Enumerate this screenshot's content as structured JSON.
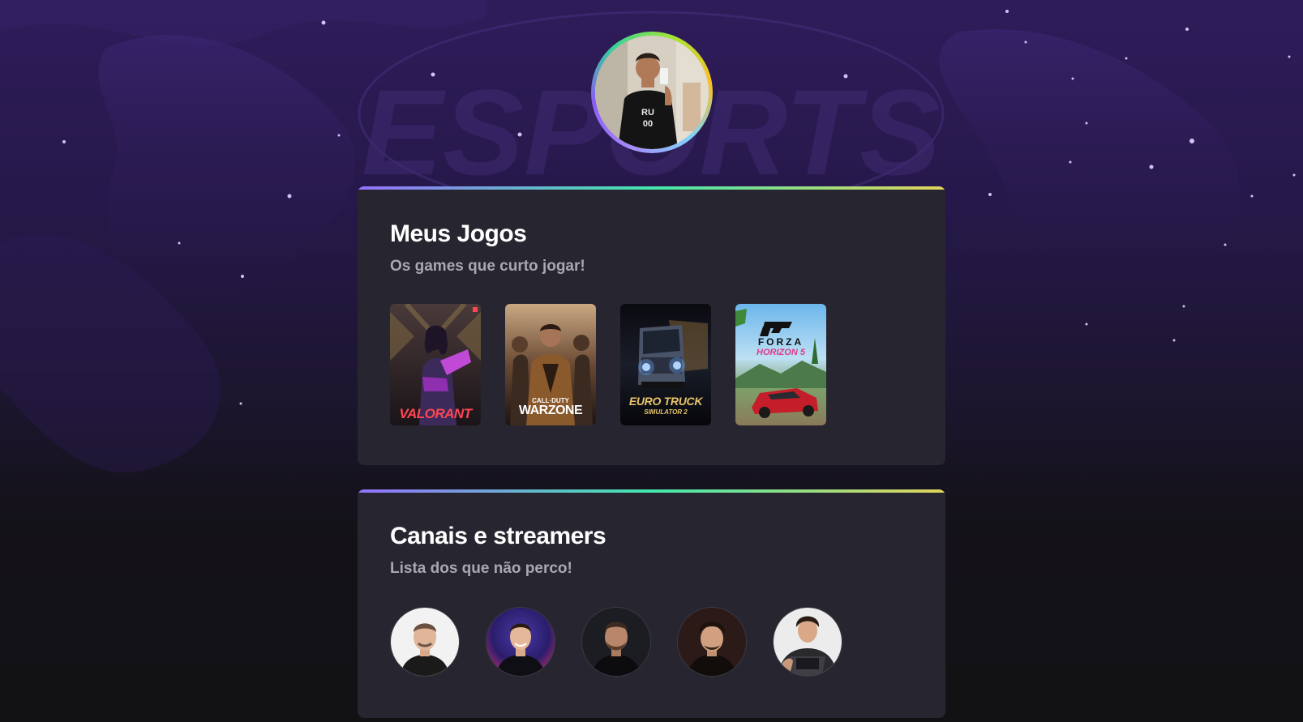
{
  "profile": {
    "avatar_alt": "Profile photo"
  },
  "background": {
    "watermark_text": "ESPORTS"
  },
  "games_section": {
    "title": "Meus Jogos",
    "subtitle": "Os games que curto jogar!",
    "games": [
      {
        "name": "valorant",
        "label": "VALORANT",
        "accent": "#ff4655"
      },
      {
        "name": "warzone",
        "label_top": "CALL·DUTY",
        "label": "WARZONE",
        "accent": "#ffffff"
      },
      {
        "name": "euro-truck",
        "label": "EURO TRUCK",
        "label_bottom": "SIMULATOR 2",
        "accent": "#e8c46a"
      },
      {
        "name": "forza-horizon-5",
        "label_top": "FORZA",
        "label": "HORIZON 5",
        "accent": "#e23a8c"
      }
    ]
  },
  "streamers_section": {
    "title": "Canais e streamers",
    "subtitle": "Lista dos que não perco!",
    "streamers": [
      {
        "name": "streamer-1",
        "bg": "#f2f2f2"
      },
      {
        "name": "streamer-2",
        "bg": "#2a1d6b"
      },
      {
        "name": "streamer-3",
        "bg": "#1c1d22"
      },
      {
        "name": "streamer-4",
        "bg": "#2b1a18"
      },
      {
        "name": "streamer-5",
        "bg": "#ececec"
      }
    ]
  },
  "colors": {
    "card_bg": "#27252f",
    "title": "#ffffff",
    "subtitle": "#a8a8b3",
    "gradient_start": "#9572fc",
    "gradient_mid": "#43e7ad",
    "gradient_end": "#e2d45c"
  }
}
